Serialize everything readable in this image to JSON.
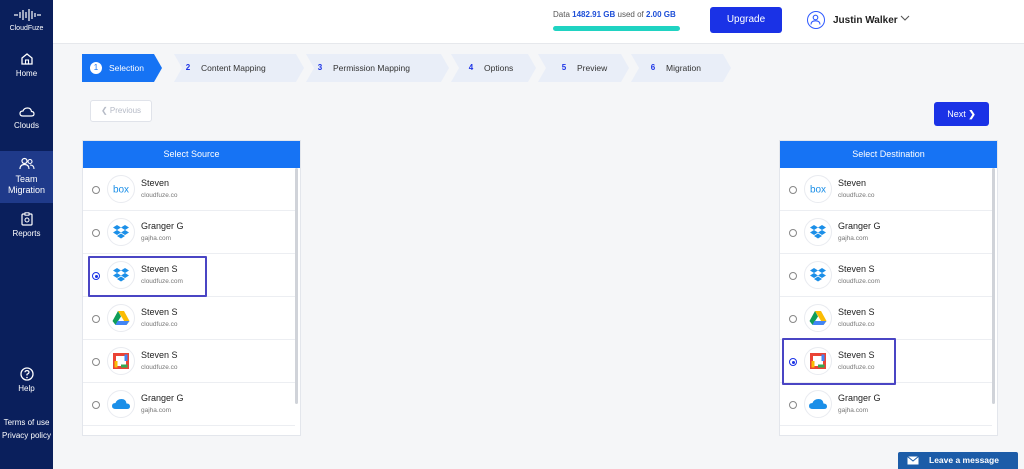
{
  "brand": {
    "name": "CloudFuze"
  },
  "sidebar": {
    "items": [
      {
        "label": "Home",
        "icon": "home-icon"
      },
      {
        "label": "Clouds",
        "icon": "cloud-icon"
      },
      {
        "label": "Team Migration",
        "icon": "users-icon",
        "active": true
      },
      {
        "label": "Reports",
        "icon": "reports-icon"
      }
    ],
    "help": "Help",
    "terms": "Terms of use",
    "privacy": "Privacy policy"
  },
  "topbar": {
    "data_prefix": "Data",
    "data_used": "1482.91 GB",
    "data_mid": "used of",
    "data_total": "2.00 GB",
    "upgrade": "Upgrade",
    "user_name": "Justin Walker"
  },
  "steps": [
    {
      "num": "1",
      "label": "Selection",
      "active": true
    },
    {
      "num": "2",
      "label": "Content Mapping"
    },
    {
      "num": "3",
      "label": "Permission Mapping"
    },
    {
      "num": "4",
      "label": "Options"
    },
    {
      "num": "5",
      "label": "Preview"
    },
    {
      "num": "6",
      "label": "Migration"
    }
  ],
  "nav": {
    "previous": "Previous",
    "next": "Next"
  },
  "source": {
    "title": "Select Source",
    "rows": [
      {
        "name": "Steven",
        "domain": "cloudfuze.co",
        "logo": "box-logo"
      },
      {
        "name": "Granger G",
        "domain": "gajha.com",
        "logo": "dropbox-logo"
      },
      {
        "name": "Steven S",
        "domain": "cloudfuze.com",
        "logo": "dropbox-logo",
        "selected": true
      },
      {
        "name": "Steven S",
        "domain": "cloudfuze.co",
        "logo": "google-drive-logo"
      },
      {
        "name": "Steven S",
        "domain": "cloudfuze.co",
        "logo": "google-workspace-logo"
      },
      {
        "name": "Granger G",
        "domain": "gajha.com",
        "logo": "onedrive-logo"
      }
    ]
  },
  "destination": {
    "title": "Select Destination",
    "rows": [
      {
        "name": "Steven",
        "domain": "cloudfuze.co",
        "logo": "box-logo"
      },
      {
        "name": "Granger G",
        "domain": "gajha.com",
        "logo": "dropbox-logo"
      },
      {
        "name": "Steven S",
        "domain": "cloudfuze.com",
        "logo": "dropbox-logo"
      },
      {
        "name": "Steven S",
        "domain": "cloudfuze.co",
        "logo": "google-drive-logo"
      },
      {
        "name": "Steven S",
        "domain": "cloudfuze.co",
        "logo": "google-workspace-logo",
        "selected": true
      },
      {
        "name": "Granger G",
        "domain": "gajha.com",
        "logo": "onedrive-logo"
      }
    ]
  },
  "chat": {
    "label": "Leave a message"
  },
  "colors": {
    "primary": "#1a32e6",
    "step_active": "#1673f4",
    "sidebar": "#0a1f5c",
    "progress": "#20d3c2"
  }
}
